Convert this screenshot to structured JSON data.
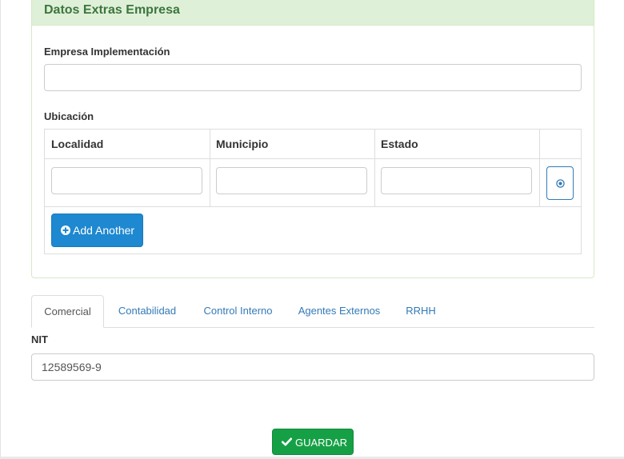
{
  "panel": {
    "title": "Datos Extras Empresa",
    "empresa_label": "Empresa Implementación",
    "empresa_value": "",
    "ubicacion_label": "Ubicación",
    "columns": [
      "Localidad",
      "Municipio",
      "Estado"
    ],
    "rows": [
      {
        "localidad": "",
        "municipio": "",
        "estado": ""
      }
    ],
    "add_button": "Add Another",
    "remove_icon": "remove-circle-icon",
    "add_icon": "plus-circle-icon"
  },
  "tabs": [
    {
      "label": "Comercial",
      "active": true
    },
    {
      "label": "Contabilidad",
      "active": false
    },
    {
      "label": "Control Interno",
      "active": false
    },
    {
      "label": "Agentes Externos",
      "active": false
    },
    {
      "label": "RRHH",
      "active": false
    }
  ],
  "nit": {
    "label": "NIT",
    "value": "12589569-9"
  },
  "save_button": {
    "label": "GUARDAR",
    "icon": "check-icon"
  },
  "colors": {
    "panel_heading_bg": "#dff0d8",
    "panel_title": "#3c763d",
    "primary": "#1e88d0",
    "link": "#337ab7",
    "success": "#16a046"
  }
}
